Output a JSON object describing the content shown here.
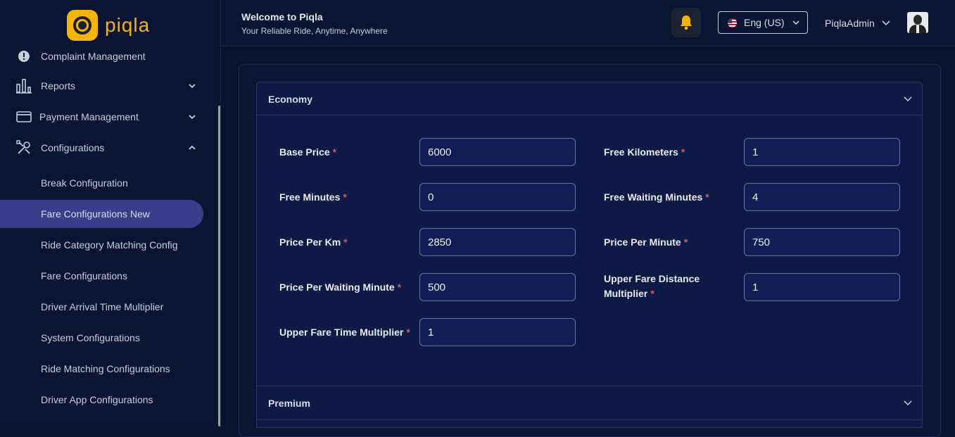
{
  "app": {
    "logo_text": "piqla"
  },
  "sidebar": {
    "items": [
      {
        "label": "Complaint Management",
        "icon": "alert-circle-icon"
      },
      {
        "label": "Reports",
        "icon": "bar-chart-icon",
        "expandable": true
      },
      {
        "label": "Payment Management",
        "icon": "credit-card-icon",
        "expandable": true
      },
      {
        "label": "Configurations",
        "icon": "tools-icon",
        "expanded": true
      }
    ],
    "sub_items": [
      {
        "label": "Break Configuration"
      },
      {
        "label": "Fare Configurations New",
        "active": true
      },
      {
        "label": "Ride Category Matching Config"
      },
      {
        "label": "Fare Configurations"
      },
      {
        "label": "Driver Arrival Time Multiplier"
      },
      {
        "label": "System Configurations"
      },
      {
        "label": "Ride Matching Configurations"
      },
      {
        "label": "Driver App Configurations"
      }
    ]
  },
  "header": {
    "title": "Welcome to Piqla",
    "subtitle": "Your Reliable Ride, Anytime, Anywhere",
    "language": "Eng (US)",
    "user_name": "PiqlaAdmin"
  },
  "panels": {
    "economy": {
      "title": "Economy",
      "fields": [
        {
          "label": "Base Price",
          "value": "6000"
        },
        {
          "label": "Free Kilometers",
          "value": "1"
        },
        {
          "label": "Free Minutes",
          "value": "0"
        },
        {
          "label": "Free Waiting Minutes",
          "value": "4"
        },
        {
          "label": "Price Per Km",
          "value": "2850"
        },
        {
          "label": "Price Per Minute",
          "value": "750"
        },
        {
          "label": "Price Per Waiting Minute",
          "value": "500"
        },
        {
          "label_line1": "Upper Fare Distance",
          "label_line2": "Multiplier",
          "value": "1"
        },
        {
          "label": "Upper Fare Time Multiplier",
          "value": "1"
        }
      ],
      "required_marker": "*"
    },
    "premium": {
      "title": "Premium"
    }
  },
  "colors": {
    "accent": "#f5b400",
    "active_nav": "#3a3c8c",
    "required": "#e05454"
  }
}
